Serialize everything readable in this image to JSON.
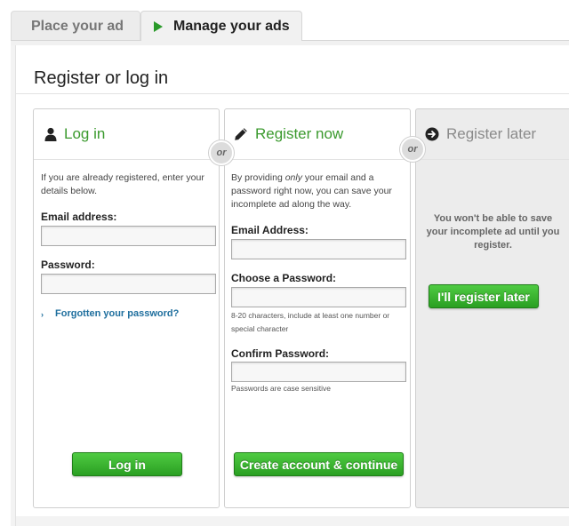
{
  "tabs": [
    {
      "label": "Place your ad",
      "active": false
    },
    {
      "label": "Manage your ads",
      "active": true
    }
  ],
  "page": {
    "title": "Register or log in"
  },
  "or_label": "or",
  "login": {
    "heading": "Log in",
    "icon": "user-icon",
    "description": "If you are already registered, enter your details below.",
    "email_label": "Email address:",
    "password_label": "Password:",
    "forgot_link": "Forgotten your password?",
    "button": "Log in"
  },
  "register": {
    "heading": "Register now",
    "icon": "pencil-icon",
    "desc_before": "By providing ",
    "desc_emph": "only",
    "desc_after": " your email and a password right now, you can save your incomplete ad along the way.",
    "email_label": "Email Address:",
    "password_label": "Choose a Password:",
    "password_hint": "8-20 characters, include at least one number or special character",
    "confirm_label": "Confirm Password:",
    "confirm_hint": "Passwords are case sensitive",
    "button": "Create account & continue"
  },
  "later": {
    "heading": "Register later",
    "icon": "arrow-circle-icon",
    "text": "You won't be able to save your incomplete ad until you register.",
    "button": "I'll register later"
  },
  "colors": {
    "accent_green": "#3b9a2e",
    "button_green": "#2a9f22",
    "link_blue": "#1f6f9e"
  }
}
